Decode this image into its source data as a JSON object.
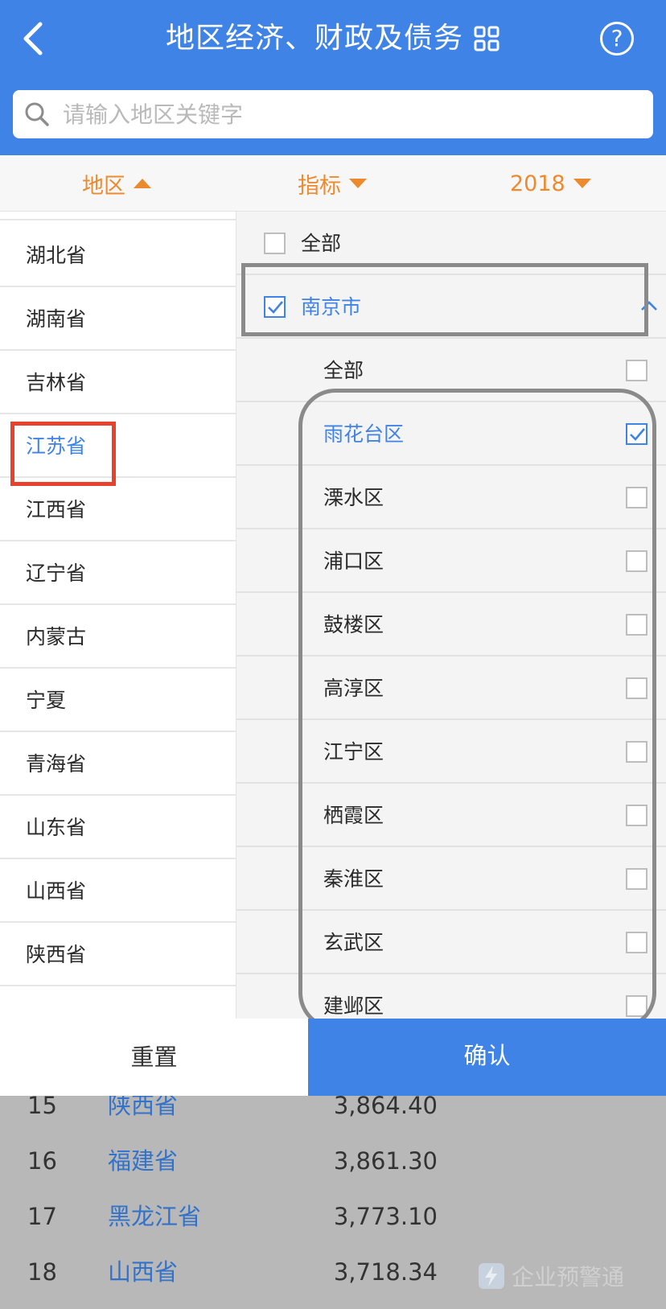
{
  "header": {
    "title": "地区经济、财政及债务",
    "help_label": "?"
  },
  "search": {
    "placeholder": "请输入地区关键字"
  },
  "filters": {
    "region_label": "地区",
    "indicator_label": "指标",
    "year_label": "2018"
  },
  "provinces": [
    "湖北省",
    "湖南省",
    "吉林省",
    "江苏省",
    "江西省",
    "辽宁省",
    "内蒙古",
    "宁夏",
    "青海省",
    "山东省",
    "山西省",
    "陕西省"
  ],
  "selected_province": "江苏省",
  "right": {
    "all_label": "全部",
    "city_label": "南京市",
    "sub_all_label": "全部",
    "districts": [
      "雨花台区",
      "溧水区",
      "浦口区",
      "鼓楼区",
      "高淳区",
      "江宁区",
      "栖霞区",
      "秦淮区",
      "玄武区",
      "建邺区"
    ],
    "checked_district": "雨花台区"
  },
  "actions": {
    "reset": "重置",
    "confirm": "确认"
  },
  "background_table": [
    {
      "rank": "15",
      "name": "陕西省",
      "value": "3,864.40"
    },
    {
      "rank": "16",
      "name": "福建省",
      "value": "3,861.30"
    },
    {
      "rank": "17",
      "name": "黑龙江省",
      "value": "3,773.10"
    },
    {
      "rank": "18",
      "name": "山西省",
      "value": "3,718.34"
    }
  ],
  "watermark": "企业预警通",
  "colors": {
    "brand_blue": "#3f83e6",
    "accent_orange": "#ec8a2f",
    "highlight_red": "#e8412c"
  }
}
